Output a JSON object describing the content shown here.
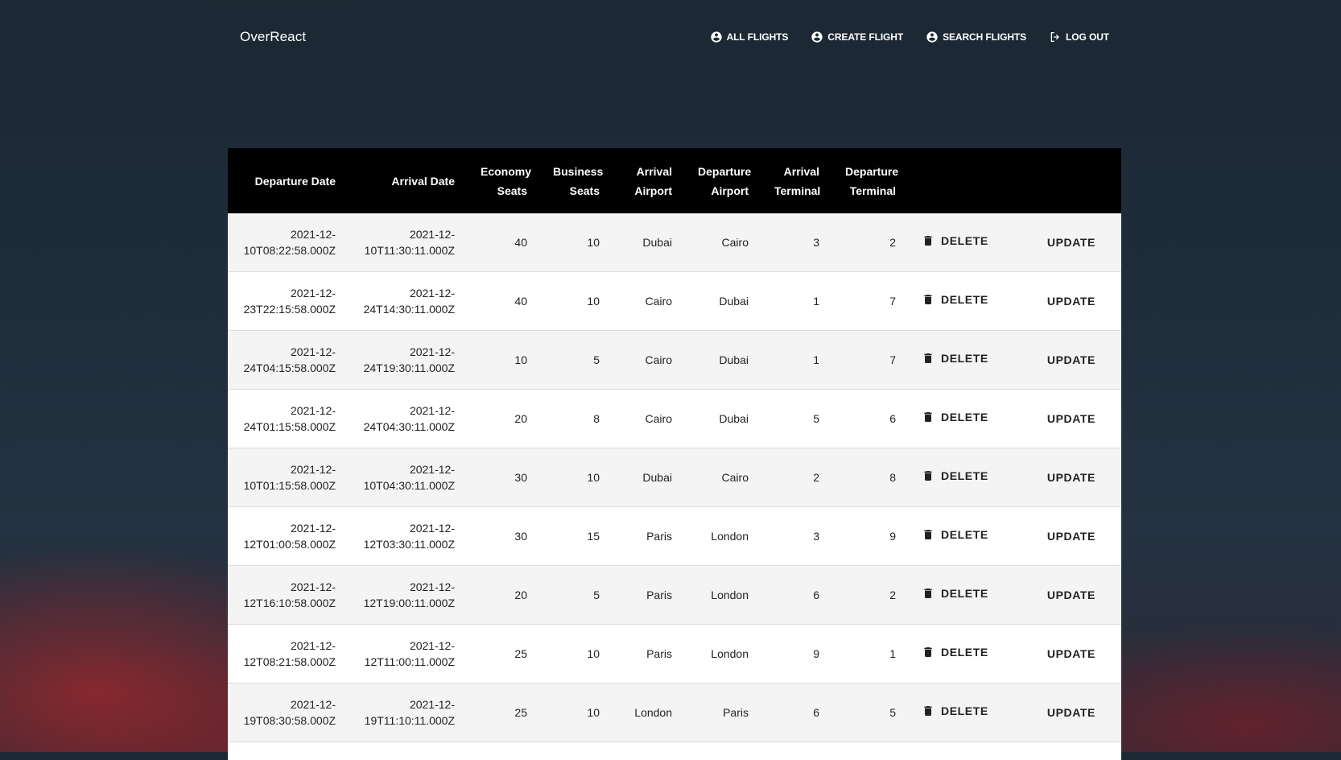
{
  "app": {
    "brand": "OverReact"
  },
  "nav": [
    {
      "label": "ALL FLIGHTS",
      "icon": "account-circle-icon"
    },
    {
      "label": "CREATE FLIGHT",
      "icon": "account-circle-icon"
    },
    {
      "label": "SEARCH FLIGHTS",
      "icon": "account-circle-icon"
    },
    {
      "label": "LOG OUT",
      "icon": "logout-icon"
    }
  ],
  "table": {
    "columns": [
      {
        "line1": "",
        "line2": "Departure Date"
      },
      {
        "line1": "",
        "line2": "Arrival Date"
      },
      {
        "line1": "Economy",
        "line2": "Seats"
      },
      {
        "line1": "Business",
        "line2": "Seats"
      },
      {
        "line1": "Arrival",
        "line2": "Airport"
      },
      {
        "line1": "Departure",
        "line2": "Airport"
      },
      {
        "line1": "Arrival",
        "line2": "Terminal"
      },
      {
        "line1": "Departure",
        "line2": "Terminal"
      }
    ],
    "delete_label": "DELETE",
    "update_label": "UPDATE",
    "rows": [
      {
        "dep1": "2021-12-",
        "dep2": "10T08:22:58.000Z",
        "arr1": "2021-12-",
        "arr2": "10T11:30:11.000Z",
        "eco": "40",
        "bus": "10",
        "arrAirport": "Dubai",
        "depAirport": "Cairo",
        "arrTerm": "3",
        "depTerm": "2"
      },
      {
        "dep1": "2021-12-",
        "dep2": "23T22:15:58.000Z",
        "arr1": "2021-12-",
        "arr2": "24T14:30:11.000Z",
        "eco": "40",
        "bus": "10",
        "arrAirport": "Cairo",
        "depAirport": "Dubai",
        "arrTerm": "1",
        "depTerm": "7"
      },
      {
        "dep1": "2021-12-",
        "dep2": "24T04:15:58.000Z",
        "arr1": "2021-12-",
        "arr2": "24T19:30:11.000Z",
        "eco": "10",
        "bus": "5",
        "arrAirport": "Cairo",
        "depAirport": "Dubai",
        "arrTerm": "1",
        "depTerm": "7"
      },
      {
        "dep1": "2021-12-",
        "dep2": "24T01:15:58.000Z",
        "arr1": "2021-12-",
        "arr2": "24T04:30:11.000Z",
        "eco": "20",
        "bus": "8",
        "arrAirport": "Cairo",
        "depAirport": "Dubai",
        "arrTerm": "5",
        "depTerm": "6"
      },
      {
        "dep1": "2021-12-",
        "dep2": "10T01:15:58.000Z",
        "arr1": "2021-12-",
        "arr2": "10T04:30:11.000Z",
        "eco": "30",
        "bus": "10",
        "arrAirport": "Dubai",
        "depAirport": "Cairo",
        "arrTerm": "2",
        "depTerm": "8"
      },
      {
        "dep1": "2021-12-",
        "dep2": "12T01:00:58.000Z",
        "arr1": "2021-12-",
        "arr2": "12T03:30:11.000Z",
        "eco": "30",
        "bus": "15",
        "arrAirport": "Paris",
        "depAirport": "London",
        "arrTerm": "3",
        "depTerm": "9"
      },
      {
        "dep1": "2021-12-",
        "dep2": "12T16:10:58.000Z",
        "arr1": "2021-12-",
        "arr2": "12T19:00:11.000Z",
        "eco": "20",
        "bus": "5",
        "arrAirport": "Paris",
        "depAirport": "London",
        "arrTerm": "6",
        "depTerm": "2"
      },
      {
        "dep1": "2021-12-",
        "dep2": "12T08:21:58.000Z",
        "arr1": "2021-12-",
        "arr2": "12T11:00:11.000Z",
        "eco": "25",
        "bus": "10",
        "arrAirport": "Paris",
        "depAirport": "London",
        "arrTerm": "9",
        "depTerm": "1"
      },
      {
        "dep1": "2021-12-",
        "dep2": "19T08:30:58.000Z",
        "arr1": "2021-12-",
        "arr2": "19T11:10:11.000Z",
        "eco": "25",
        "bus": "10",
        "arrAirport": "London",
        "depAirport": "Paris",
        "arrTerm": "6",
        "depTerm": "5"
      }
    ]
  }
}
